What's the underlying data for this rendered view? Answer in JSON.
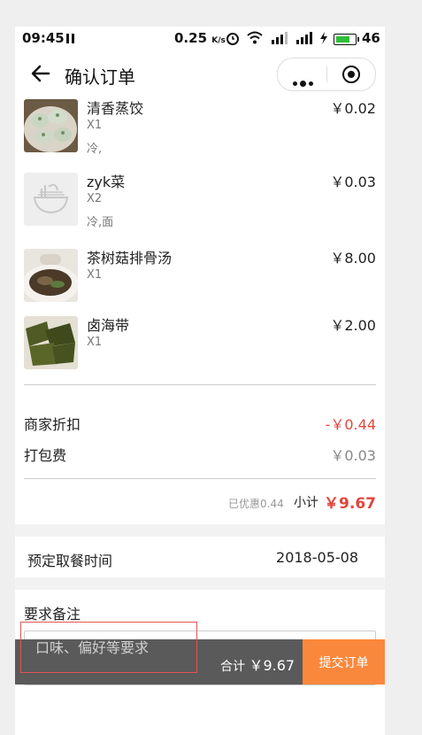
{
  "status_bar": {
    "time": "09:45",
    "speed": "0.25",
    "speed_unit": "K/s",
    "battery": "46"
  },
  "nav": {
    "title": "确认订单"
  },
  "items": [
    {
      "name": "清香蒸饺",
      "qty": "X1",
      "note": "冷,",
      "price": "￥0.02"
    },
    {
      "name": "zyk菜",
      "qty": "X2",
      "note": "冷,面",
      "price": "￥0.03"
    },
    {
      "name": "茶树菇排骨汤",
      "qty": "X1",
      "note": "",
      "price": "￥8.00"
    },
    {
      "name": "卤海带",
      "qty": "X1",
      "note": "",
      "price": "￥2.00"
    }
  ],
  "summary": {
    "discount_label": "商家折扣",
    "discount_value": "-￥0.44",
    "packing_label": "打包费",
    "packing_value": "￥0.03",
    "saved_text": "已优惠0.44",
    "subtotal_label": "小计",
    "subtotal_value": "￥9.67"
  },
  "pickup": {
    "label": "预定取餐时间",
    "value": "2018-05-08"
  },
  "remarks": {
    "label": "要求备注",
    "placeholder": "口味、偏好等要求"
  },
  "bottom_bar": {
    "total_label": "合计",
    "total_value": "￥9.67",
    "submit_label": "提交订单"
  },
  "colors": {
    "accent": "#f9883d",
    "price_red": "#e2453c",
    "bar_dark": "#5a5a5a"
  }
}
